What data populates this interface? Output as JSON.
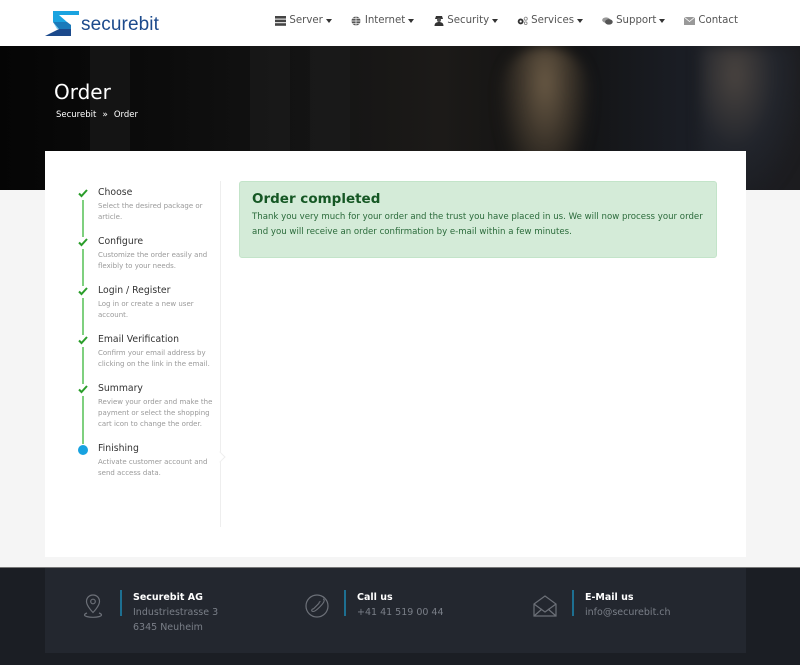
{
  "header": {
    "brand": "securebit",
    "logo_colors": {
      "light": "#1aa3e0",
      "dark": "#1c4a8c"
    },
    "nav": [
      {
        "label": "Server",
        "icon": "server-icon",
        "dropdown": true
      },
      {
        "label": "Internet",
        "icon": "globe-icon",
        "dropdown": true
      },
      {
        "label": "Security",
        "icon": "user-secret-icon",
        "dropdown": true
      },
      {
        "label": "Services",
        "icon": "cogs-icon",
        "dropdown": true
      },
      {
        "label": "Support",
        "icon": "comments-icon",
        "dropdown": true
      },
      {
        "label": "Contact",
        "icon": "envelope-icon",
        "dropdown": false
      }
    ]
  },
  "hero": {
    "title": "Order",
    "breadcrumb": [
      "Securebit",
      "Order"
    ],
    "breadcrumb_separator": "»"
  },
  "steps": [
    {
      "title": "Choose",
      "desc": [
        "Select the desired package or",
        "article."
      ],
      "status": "done"
    },
    {
      "title": "Configure",
      "desc": [
        "Customize the order easily and",
        "flexibly to your needs."
      ],
      "status": "done"
    },
    {
      "title": "Login / Register",
      "desc": [
        "Log in or create a new user",
        "account."
      ],
      "status": "done"
    },
    {
      "title": "Email Verification",
      "desc": [
        "Confirm your email address by",
        "clicking on the link in the email."
      ],
      "status": "done"
    },
    {
      "title": "Summary",
      "desc": [
        "Review your order and make the",
        "payment or select the shopping",
        "cart icon to change the order."
      ],
      "status": "done"
    },
    {
      "title": "Finishing",
      "desc": [
        "Activate customer account and",
        "send access data."
      ],
      "status": "current"
    }
  ],
  "alert": {
    "title": "Order completed",
    "text": "Thank you very much for your order and the trust you have placed in us. We will now process your order and you will receive an order confirmation by e-mail within a few minutes.",
    "colors": {
      "bg": "#d4ebd8",
      "text": "#155724"
    }
  },
  "footer": {
    "address": {
      "title": "Securebit AG",
      "lines": [
        "Industriestrasse 3",
        "6345 Neuheim"
      ]
    },
    "phone": {
      "title": "Call us",
      "lines": [
        "+41 41 519 00 44"
      ]
    },
    "email": {
      "title": "E-Mail us",
      "lines": [
        "info@securebit.ch"
      ]
    }
  },
  "colors": {
    "check": "#2a9d2a",
    "progress_line": "#7fd07f",
    "current_dot": "#17a2e0",
    "footer_accent": "#1d6f91"
  }
}
